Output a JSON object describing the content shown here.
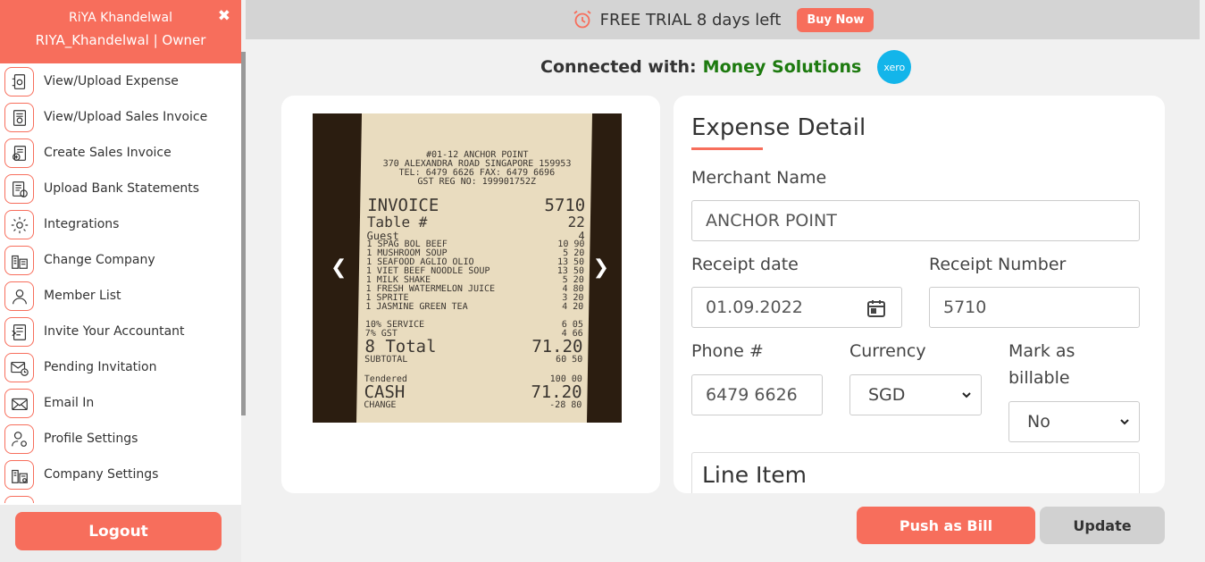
{
  "user": {
    "name": "RiYA Khandelwal",
    "role_line": "RIYA_Khandelwal | Owner",
    "close_glyph": "✖"
  },
  "sidebar": {
    "items": [
      {
        "label": "View/Upload Expense",
        "icon": "expense-upload-icon"
      },
      {
        "label": "View/Upload Sales Invoice",
        "icon": "sales-invoice-icon"
      },
      {
        "label": "Create Sales Invoice",
        "icon": "create-invoice-icon"
      },
      {
        "label": "Upload Bank Statements",
        "icon": "bank-statement-icon"
      },
      {
        "label": "Integrations",
        "icon": "gear-icon"
      },
      {
        "label": "Change Company",
        "icon": "buildings-icon"
      },
      {
        "label": "Member List",
        "icon": "user-icon"
      },
      {
        "label": "Invite Your Accountant",
        "icon": "invite-icon"
      },
      {
        "label": "Pending Invitation",
        "icon": "pending-mail-icon"
      },
      {
        "label": "Email In",
        "icon": "envelope-icon"
      },
      {
        "label": "Profile Settings",
        "icon": "user-settings-icon"
      },
      {
        "label": "Company Settings",
        "icon": "company-settings-icon"
      }
    ],
    "logout_label": "Logout"
  },
  "banner": {
    "text": "FREE TRIAL 8 days left",
    "buy_label": "Buy Now"
  },
  "connection": {
    "label": "Connected with:",
    "company": "Money Solutions",
    "logo_text": "xero"
  },
  "receipt": {
    "header": [
      "#01-12 ANCHOR POINT",
      "370 ALEXANDRA ROAD SINGAPORE 159953",
      "TEL: 6479 6626 FAX: 6479 6696",
      "GST REG NO: 199901752Z"
    ],
    "invoice_label": "INVOICE",
    "invoice_no": "5710",
    "table_label": "Table #",
    "table_no": "22",
    "guest_label": "Guest",
    "guest_no": "4",
    "items": [
      {
        "name": "1 SPAG  BOL BEEF",
        "price": "10 90"
      },
      {
        "name": "1 MUSHROOM SOUP",
        "price": "5 20"
      },
      {
        "name": "1 SEAFOOD AGLIO OLIO",
        "price": "13 50"
      },
      {
        "name": "1 VIET BEEF NOODLE SOUP",
        "price": "13 50"
      },
      {
        "name": "1 MILK SHAKE",
        "price": "5 20"
      },
      {
        "name": "1 FRESH WATERMELON JUICE",
        "price": "4 80"
      },
      {
        "name": "1 SPRITE",
        "price": "3 20"
      },
      {
        "name": "1 JASMINE GREEN TEA",
        "price": "4 20"
      }
    ],
    "service_label": "10% SERVICE",
    "service": "6 05",
    "gst_label": "7% GST",
    "gst": "4 66",
    "total_label": "8 Total",
    "total": "71.20",
    "subtotal_label": "SUBTOTAL",
    "subtotal": "60 50",
    "tendered_label": "Tendered",
    "tendered": "100 00",
    "cash_label": "CASH",
    "cash": "71.20",
    "change_label": "CHANGE",
    "change": "-28 80"
  },
  "detail": {
    "title": "Expense Detail",
    "merchant_label": "Merchant Name",
    "merchant_value": "ANCHOR POINT",
    "date_label": "Receipt date",
    "date_value": "01.09.2022",
    "receipt_no_label": "Receipt Number",
    "receipt_no_value": "5710",
    "phone_label": "Phone #",
    "phone_value": "6479 6626",
    "currency_label": "Currency",
    "currency_value": "SGD",
    "billable_label": "Mark as billable",
    "billable_value": "No",
    "line_item_title": "Line Item"
  },
  "actions": {
    "push_label": "Push as Bill",
    "update_label": "Update"
  },
  "colors": {
    "accent": "#f76e5c",
    "connected_green": "#1d7a0f",
    "xero_blue": "#13b5ea"
  }
}
